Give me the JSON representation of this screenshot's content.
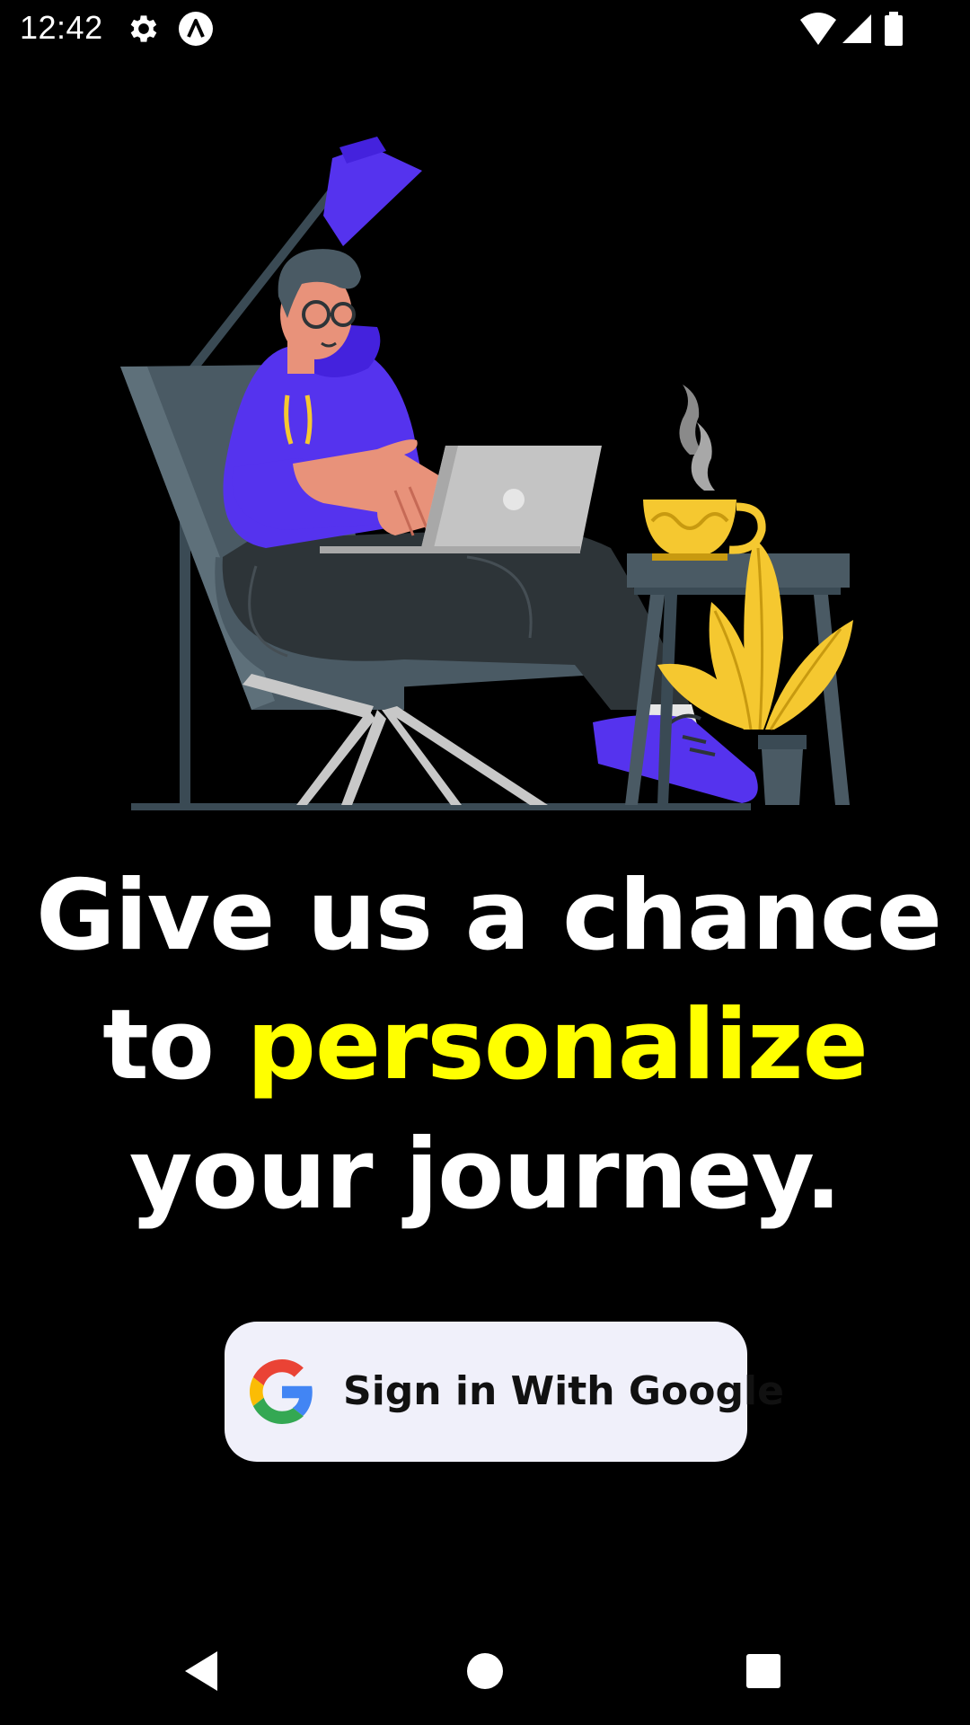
{
  "status_bar": {
    "time": "12:42",
    "left_icons": [
      "gear-icon",
      "app-a-icon"
    ],
    "right_icons": [
      "wifi-icon",
      "signal-icon",
      "battery-icon"
    ]
  },
  "illustration": {
    "icon": "person-working-on-laptop-illustration",
    "colors": {
      "purple": "#5533ee",
      "chair": "#4a5a64",
      "laptop": "#c4c4c4",
      "yellow": "#f5c830"
    }
  },
  "headline": {
    "line1": "Give us a chance",
    "line2_prefix": "to ",
    "line2_accent": "personalize",
    "line3": "your journey.",
    "accent_color": "#ffff00"
  },
  "google_button": {
    "label": "Sign in With Google",
    "icon": "google-g-icon"
  },
  "nav_bar": {
    "buttons": [
      "back-icon",
      "home-icon",
      "recents-icon"
    ]
  },
  "colors": {
    "background": "#000000",
    "text": "#ffffff",
    "button_bg": "#f0f0fa"
  }
}
